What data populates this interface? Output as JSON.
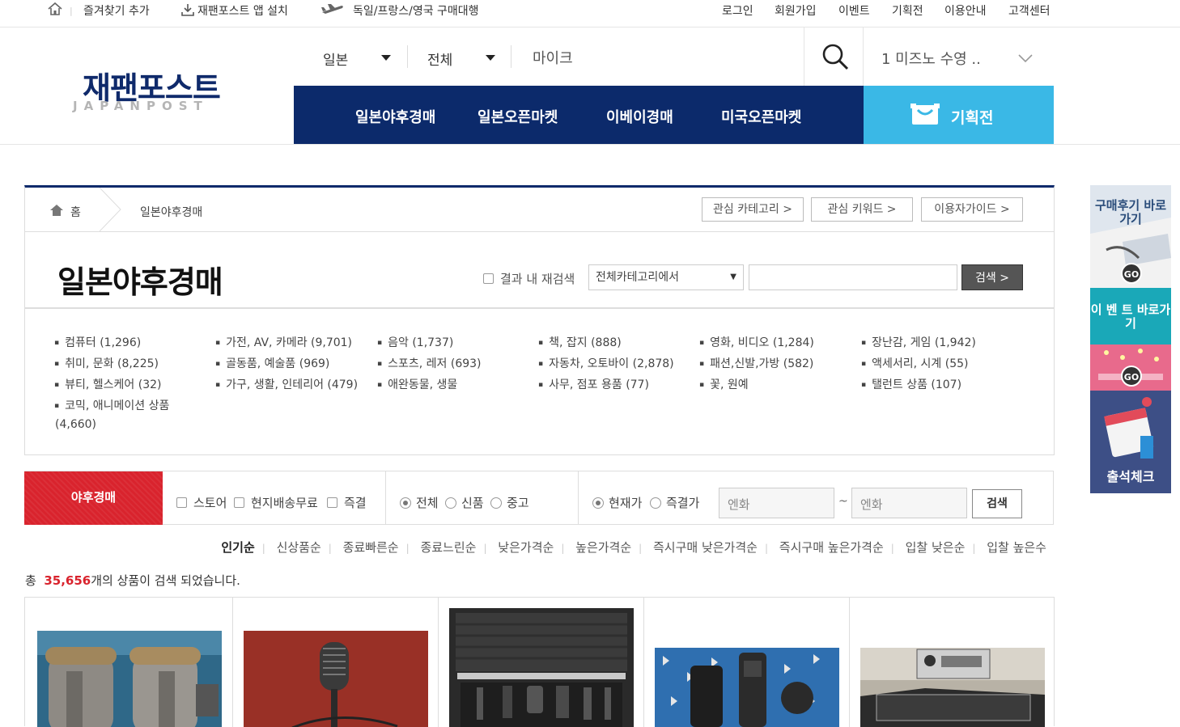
{
  "topbar": {
    "bookmark": "즐겨찾기 추가",
    "app_install": "재팬포스트 앱 설치",
    "proxy": "독일/프랑스/영국 구매대행",
    "login": "로그인",
    "signup": "회원가입",
    "event": "이벤트",
    "special": "기획전",
    "guide": "이용안내",
    "support": "고객센터"
  },
  "logo": {
    "ko": "재팬포스트",
    "en": "JAPANPOST"
  },
  "search": {
    "market_select": "일본",
    "category_select": "전체",
    "query": "마이크"
  },
  "recent_search": "1 미즈노 수영 ..",
  "nav": {
    "tabs": [
      "일본야후경매",
      "일본오픈마켓",
      "이베이경매",
      "미국오픈마켓"
    ],
    "special_label": "기획전"
  },
  "breadcrumb": {
    "home": "홈",
    "current": "일본야후경매",
    "btn_fav_category": "관심 카테고리 >",
    "btn_fav_keyword": "관심 키워드 >",
    "btn_user_guide": "이용자가이드 >"
  },
  "page_title": "일본야후경매",
  "refine": {
    "label": "결과 내 재검색",
    "category": "전체카테고리에서",
    "button": "검색 >"
  },
  "categories": [
    "컴퓨터 (1,296)",
    "가전, AV, 카메라 (9,701)",
    "음악 (1,737)",
    "책, 잡지 (888)",
    "영화, 비디오 (1,284)",
    "장난감, 게임 (1,942)",
    "취미, 문화 (8,225)",
    "골동품, 예술품 (969)",
    "스포츠, 레저 (693)",
    "자동차, 오토바이 (2,878)",
    "패션,신발,가방 (582)",
    "액세서리, 시계 (55)",
    "뷰티, 헬스케어 (32)",
    "가구, 생활, 인테리어 (479)",
    "애완동물, 생물",
    "사무, 점포 용품 (77)",
    "꽃, 원예",
    "탤런트 상품 (107)",
    "코믹, 애니메이션 상품",
    "(4,660)"
  ],
  "filter": {
    "label": "야후경매",
    "store": "스토어",
    "free_shipping": "현지배송무료",
    "buy_now": "즉결",
    "cond_all": "전체",
    "cond_new": "신품",
    "cond_used": "중고",
    "price_current": "현재가",
    "price_buynow": "즉결가",
    "price_min_placeholder": "엔화",
    "price_max_placeholder": "엔화",
    "tilde": "~",
    "search_button": "검색"
  },
  "sort": [
    "인기순",
    "신상품순",
    "종료빠른순",
    "종료느린순",
    "낮은가격순",
    "높은가격순",
    "즉시구매 낮은가격순",
    "즉시구매 높은가격순",
    "입찰 낮은순",
    "입찰 높은수"
  ],
  "total": {
    "prefix": "총",
    "count": "35,656",
    "suffix": "개의 상품이 검색 되었습니다."
  },
  "quick_menu": {
    "review": "구매후기 바로가기",
    "event": "이 벤 트 바로가기",
    "attendance": "출석체크",
    "go": "GO"
  },
  "colors": {
    "navy": "#0c2a6b",
    "sky": "#3ab8e6",
    "red": "#d9232d"
  }
}
